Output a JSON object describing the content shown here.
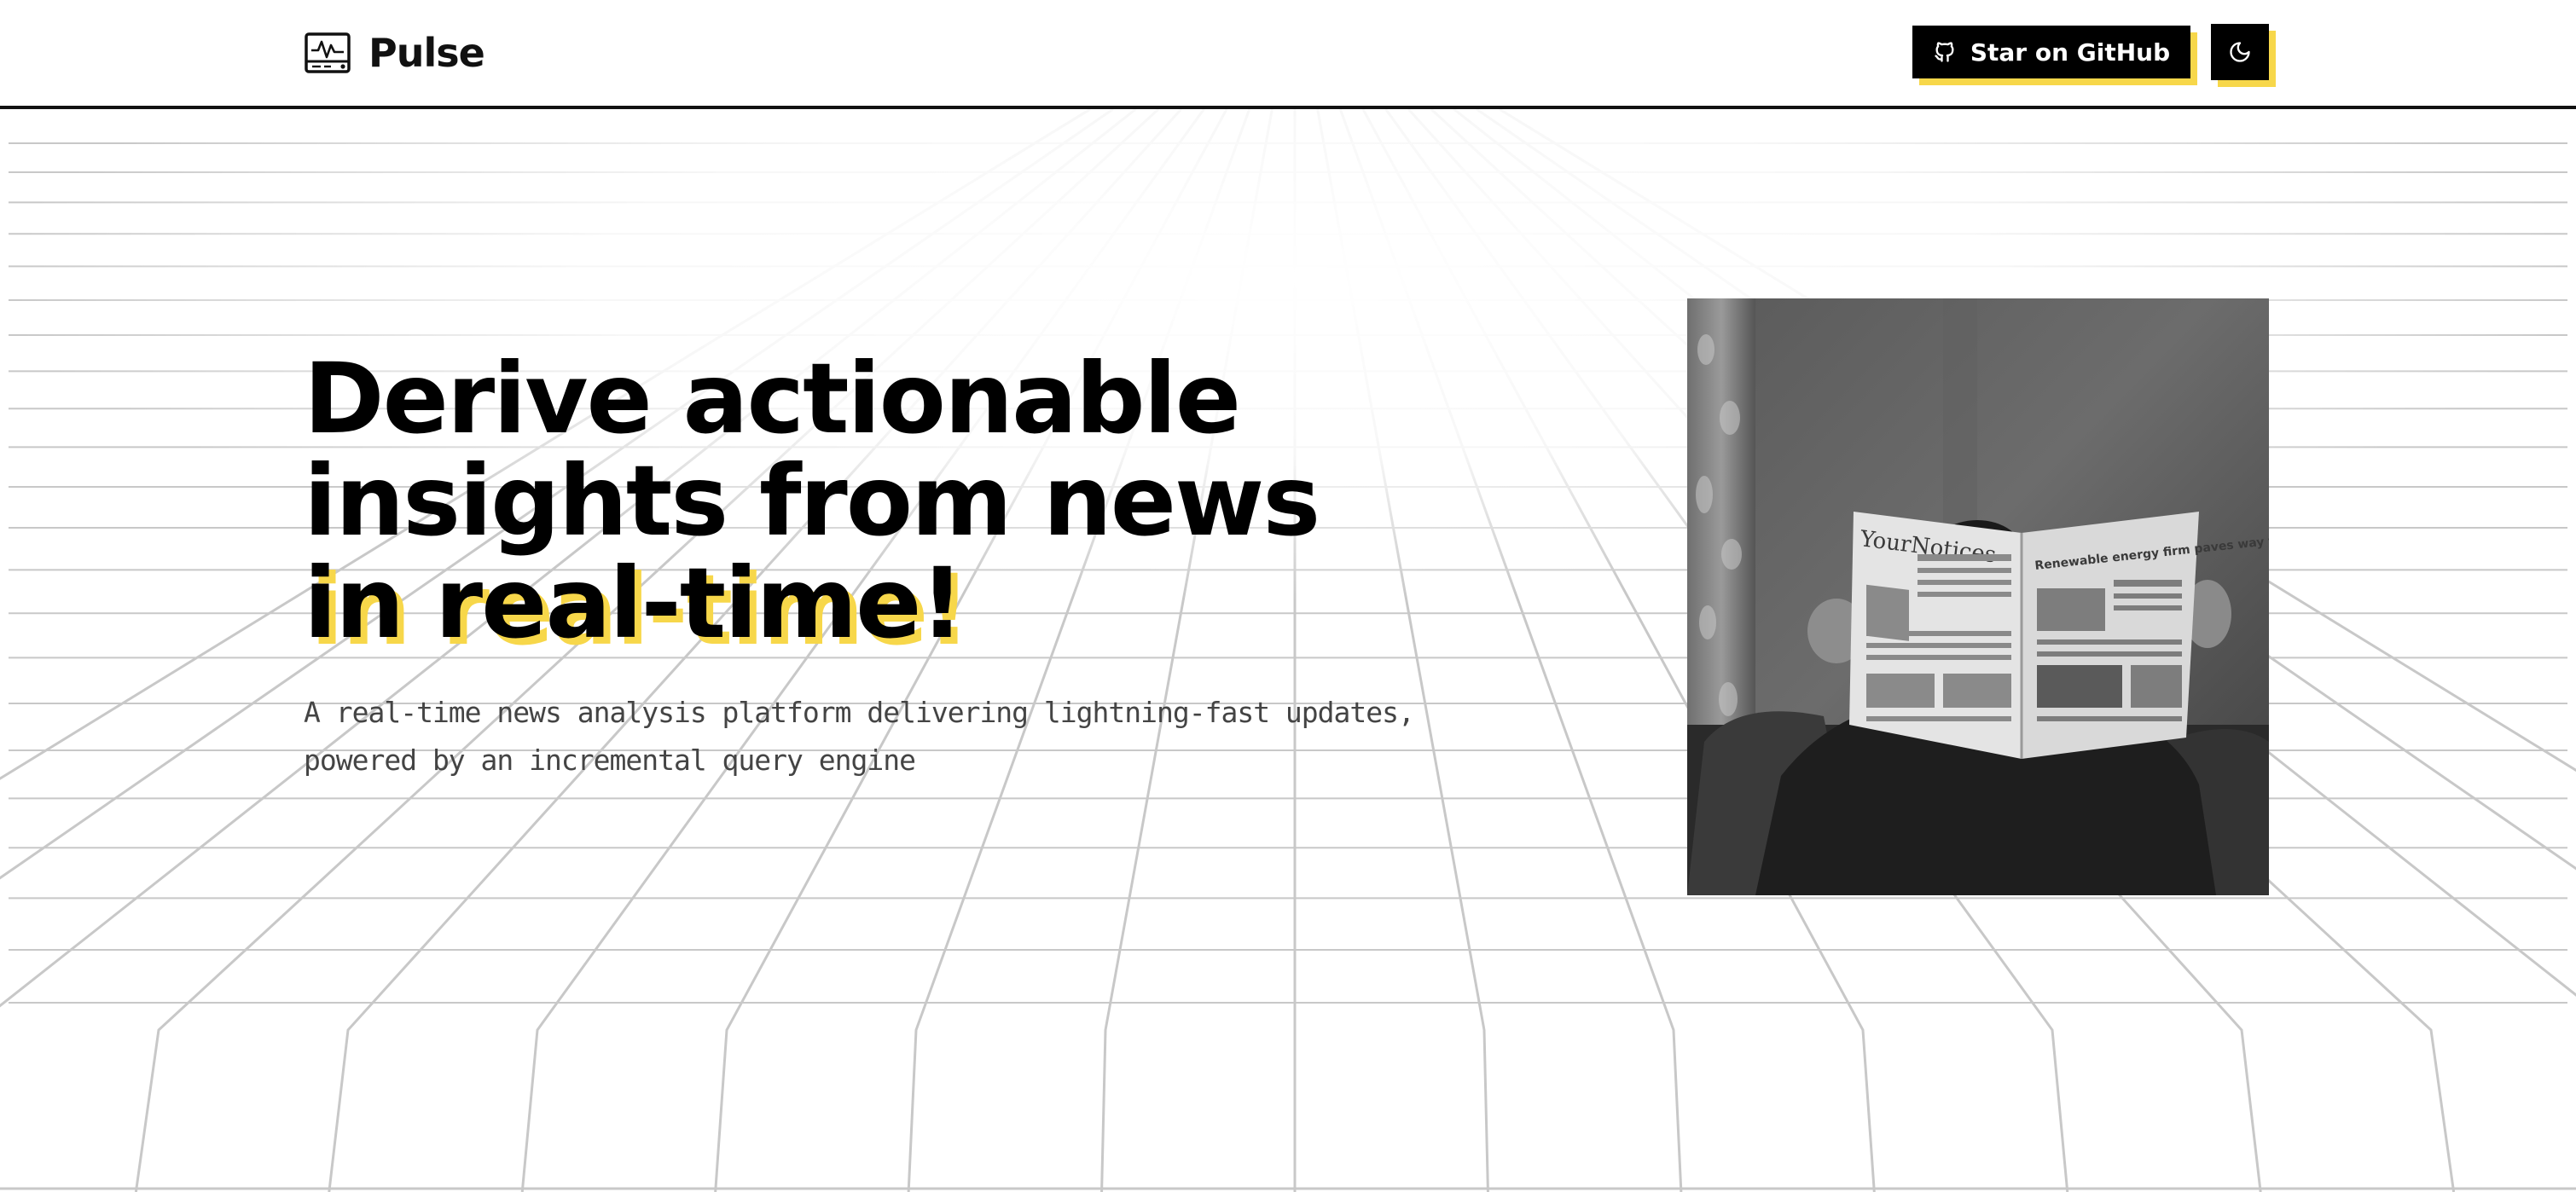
{
  "header": {
    "brand_name": "Pulse",
    "brand_icon": "monitor-pulse-icon",
    "github_button_label": "Star on GitHub",
    "github_icon": "github-icon",
    "theme_toggle_icon": "moon-icon"
  },
  "hero": {
    "headline_line1": "Derive actionable",
    "headline_line2": "insights from news",
    "headline_line3": "in real-time!",
    "subtitle": "A real-time news analysis platform delivering lightning-fast updates, powered by an incremental query engine",
    "image_newspaper_masthead": "YourNotices",
    "image_newspaper_headline": "Renewable energy firm paves way to new jobs"
  },
  "colors": {
    "accent": "#f7d74a",
    "text": "#000000",
    "subtitle_text": "#444444",
    "background": "#ffffff",
    "grid_line": "#c8c8c8"
  }
}
